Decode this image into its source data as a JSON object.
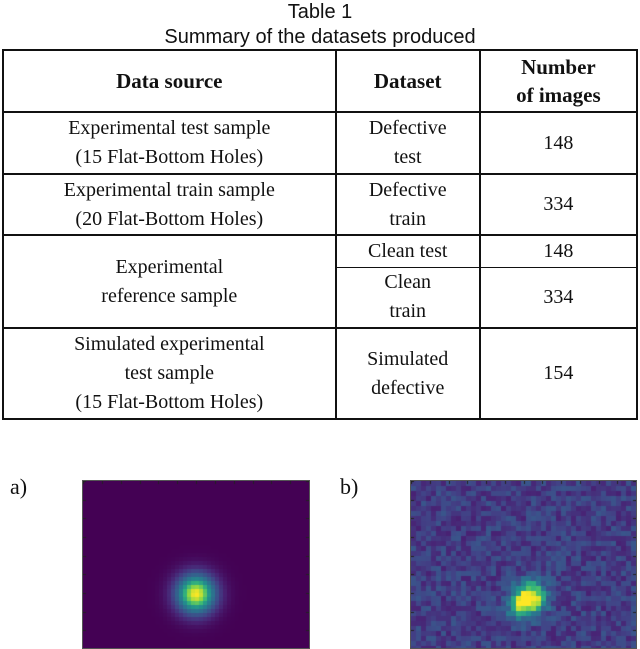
{
  "caption": {
    "label": "Table 1",
    "title": "Summary of the datasets produced"
  },
  "table": {
    "headers": [
      "Data source",
      "Dataset",
      "Number of images"
    ],
    "header_lines": {
      "number_line1": "Number",
      "number_line2": "of images"
    },
    "rows": [
      {
        "source_line1": "Experimental test sample",
        "source_line2": "(15 Flat-Bottom Holes)",
        "dataset_line1": "Defective",
        "dataset_line2": "test",
        "count": "148"
      },
      {
        "source_line1": "Experimental train sample",
        "source_line2": "(20 Flat-Bottom Holes)",
        "dataset_line1": "Defective",
        "dataset_line2": "train",
        "count": "334"
      },
      {
        "source_line1": "Experimental",
        "source_line2": "reference sample",
        "sub": [
          {
            "dataset_line1": "Clean test",
            "count": "148"
          },
          {
            "dataset_line1": "Clean",
            "dataset_line2": "train",
            "count": "334"
          }
        ]
      },
      {
        "source_line1": "Simulated experimental",
        "source_line2": "test sample",
        "source_line3": "(15 Flat-Bottom Holes)",
        "dataset_line1": "Simulated",
        "dataset_line2": "defective",
        "count": "154"
      }
    ]
  },
  "figures": {
    "a": {
      "label": "a)",
      "description": "simulated defect heatmap",
      "colormap": "viridis",
      "colors": {
        "background": "#440154",
        "peak": "#fde725"
      }
    },
    "b": {
      "label": "b)",
      "description": "experimental defect heatmap",
      "colormap": "viridis",
      "colors": {
        "background": "#3b2b78",
        "peak": "#fde725"
      }
    }
  }
}
